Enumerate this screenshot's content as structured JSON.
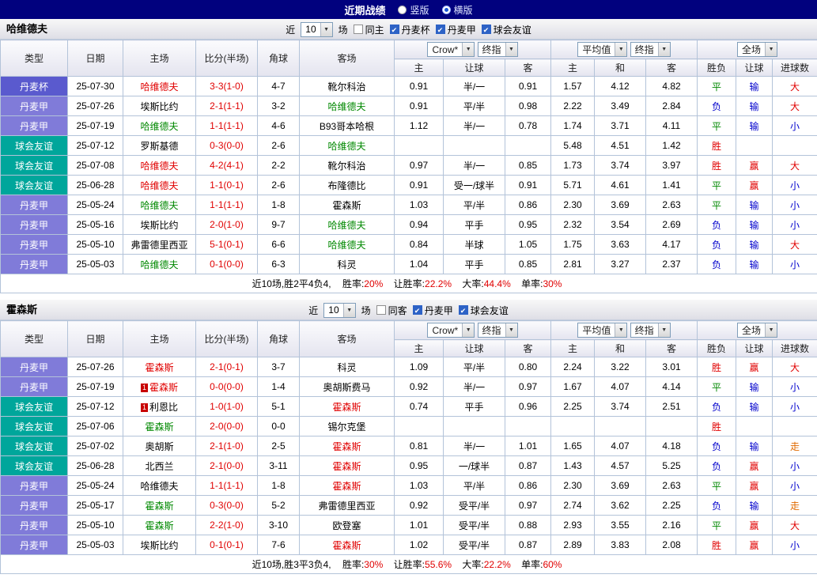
{
  "titlebar": {
    "title": "近期战绩",
    "radios": [
      {
        "label": "竖版",
        "checked": false
      },
      {
        "label": "横版",
        "checked": true
      }
    ]
  },
  "columns": {
    "type": "类型",
    "date": "日期",
    "home": "主场",
    "score": "比分(半场)",
    "corner": "角球",
    "away": "客场",
    "odds_home": "主",
    "odds_line": "让球",
    "odds_away": "客",
    "avg_home": "主",
    "avg_draw": "和",
    "avg_away": "客",
    "res_wdl": "胜负",
    "res_handicap": "让球",
    "res_goals": "进球数"
  },
  "league_colors": {
    "cup": "#5a5ace",
    "league": "#807bd9",
    "friendly": "#00a69b"
  },
  "result_colors": {
    "win": "#e00000",
    "draw": "#008800",
    "loss": "#0000cc",
    "push": "#e06a00"
  },
  "sections": [
    {
      "team": "哈维德夫",
      "filter": {
        "near": "近",
        "count": "10",
        "matches": "场",
        "checkboxes": [
          {
            "label": "同主",
            "checked": false
          },
          {
            "label": "丹麦杯",
            "checked": true
          },
          {
            "label": "丹麦甲",
            "checked": true
          },
          {
            "label": "球会友谊",
            "checked": true
          }
        ]
      },
      "dropdowns": {
        "bookmaker": "Crow*",
        "book_time": "终指",
        "avg": "平均值",
        "avg_time": "终指",
        "scope": "全场"
      },
      "rows": [
        {
          "league": "丹麦杯",
          "cls": "cup",
          "date": "25-07-30",
          "home": {
            "name": "哈维德夫",
            "color": "red"
          },
          "score": "3-3(1-0)",
          "corner": "4-7",
          "away": {
            "name": "靴尔科治",
            "color": "black"
          },
          "odds": [
            "0.91",
            "半/一",
            "0.91"
          ],
          "avg": [
            "1.57",
            "4.12",
            "4.82"
          ],
          "wdl": {
            "t": "平",
            "c": "green"
          },
          "let": {
            "t": "输",
            "c": "blue"
          },
          "goal": {
            "t": "大",
            "c": "red"
          }
        },
        {
          "league": "丹麦甲",
          "cls": "league",
          "date": "25-07-26",
          "home": {
            "name": "埃斯比约",
            "color": "black"
          },
          "score": "2-1(1-1)",
          "corner": "3-2",
          "away": {
            "name": "哈维德夫",
            "color": "green"
          },
          "odds": [
            "0.91",
            "平/半",
            "0.98"
          ],
          "avg": [
            "2.22",
            "3.49",
            "2.84"
          ],
          "wdl": {
            "t": "负",
            "c": "blue"
          },
          "let": {
            "t": "输",
            "c": "blue"
          },
          "goal": {
            "t": "大",
            "c": "red"
          }
        },
        {
          "league": "丹麦甲",
          "cls": "league",
          "date": "25-07-19",
          "home": {
            "name": "哈维德夫",
            "color": "green"
          },
          "score": "1-1(1-1)",
          "corner": "4-6",
          "away": {
            "name": "B93哥本哈根",
            "color": "black"
          },
          "odds": [
            "1.12",
            "半/一",
            "0.78"
          ],
          "avg": [
            "1.74",
            "3.71",
            "4.11"
          ],
          "wdl": {
            "t": "平",
            "c": "green"
          },
          "let": {
            "t": "输",
            "c": "blue"
          },
          "goal": {
            "t": "小",
            "c": "blue"
          }
        },
        {
          "league": "球会友谊",
          "cls": "friendly",
          "date": "25-07-12",
          "home": {
            "name": "罗斯基德",
            "color": "black"
          },
          "score": "0-3(0-0)",
          "corner": "2-6",
          "away": {
            "name": "哈维德夫",
            "color": "green"
          },
          "odds": [
            "",
            "",
            ""
          ],
          "avg": [
            "5.48",
            "4.51",
            "1.42"
          ],
          "wdl": {
            "t": "胜",
            "c": "red"
          },
          "let": {
            "t": "",
            "c": "black"
          },
          "goal": {
            "t": "",
            "c": "black"
          }
        },
        {
          "league": "球会友谊",
          "cls": "friendly",
          "date": "25-07-08",
          "home": {
            "name": "哈维德夫",
            "color": "red"
          },
          "score": "4-2(4-1)",
          "corner": "2-2",
          "away": {
            "name": "靴尔科治",
            "color": "black"
          },
          "odds": [
            "0.97",
            "半/一",
            "0.85"
          ],
          "avg": [
            "1.73",
            "3.74",
            "3.97"
          ],
          "wdl": {
            "t": "胜",
            "c": "red"
          },
          "let": {
            "t": "赢",
            "c": "red"
          },
          "goal": {
            "t": "大",
            "c": "red"
          }
        },
        {
          "league": "球会友谊",
          "cls": "friendly",
          "date": "25-06-28",
          "home": {
            "name": "哈维德夫",
            "color": "red"
          },
          "score": "1-1(0-1)",
          "corner": "2-6",
          "away": {
            "name": "布隆德比",
            "color": "black"
          },
          "odds": [
            "0.91",
            "受一/球半",
            "0.91"
          ],
          "avg": [
            "5.71",
            "4.61",
            "1.41"
          ],
          "wdl": {
            "t": "平",
            "c": "green"
          },
          "let": {
            "t": "赢",
            "c": "red"
          },
          "goal": {
            "t": "小",
            "c": "blue"
          }
        },
        {
          "league": "丹麦甲",
          "cls": "league",
          "date": "25-05-24",
          "home": {
            "name": "哈维德夫",
            "color": "green"
          },
          "score": "1-1(1-1)",
          "corner": "1-8",
          "away": {
            "name": "霍森斯",
            "color": "black"
          },
          "odds": [
            "1.03",
            "平/半",
            "0.86"
          ],
          "avg": [
            "2.30",
            "3.69",
            "2.63"
          ],
          "wdl": {
            "t": "平",
            "c": "green"
          },
          "let": {
            "t": "输",
            "c": "blue"
          },
          "goal": {
            "t": "小",
            "c": "blue"
          }
        },
        {
          "league": "丹麦甲",
          "cls": "league",
          "date": "25-05-16",
          "home": {
            "name": "埃斯比约",
            "color": "black"
          },
          "score": "2-0(1-0)",
          "corner": "9-7",
          "away": {
            "name": "哈维德夫",
            "color": "green"
          },
          "odds": [
            "0.94",
            "平手",
            "0.95"
          ],
          "avg": [
            "2.32",
            "3.54",
            "2.69"
          ],
          "wdl": {
            "t": "负",
            "c": "blue"
          },
          "let": {
            "t": "输",
            "c": "blue"
          },
          "goal": {
            "t": "小",
            "c": "blue"
          }
        },
        {
          "league": "丹麦甲",
          "cls": "league",
          "date": "25-05-10",
          "home": {
            "name": "弗雷德里西亚",
            "color": "black"
          },
          "score": "5-1(0-1)",
          "corner": "6-6",
          "away": {
            "name": "哈维德夫",
            "color": "green"
          },
          "odds": [
            "0.84",
            "半球",
            "1.05"
          ],
          "avg": [
            "1.75",
            "3.63",
            "4.17"
          ],
          "wdl": {
            "t": "负",
            "c": "blue"
          },
          "let": {
            "t": "输",
            "c": "blue"
          },
          "goal": {
            "t": "大",
            "c": "red"
          }
        },
        {
          "league": "丹麦甲",
          "cls": "league",
          "date": "25-05-03",
          "home": {
            "name": "哈维德夫",
            "color": "green"
          },
          "score": "0-1(0-0)",
          "corner": "6-3",
          "away": {
            "name": "科灵",
            "color": "black"
          },
          "odds": [
            "1.04",
            "平手",
            "0.85"
          ],
          "avg": [
            "2.81",
            "3.27",
            "2.37"
          ],
          "wdl": {
            "t": "负",
            "c": "blue"
          },
          "let": {
            "t": "输",
            "c": "blue"
          },
          "goal": {
            "t": "小",
            "c": "blue"
          }
        }
      ],
      "summary": {
        "prefix": "近10场,胜2平4负4,",
        "stats": [
          {
            "label": "胜率:",
            "value": "20%"
          },
          {
            "label": "让胜率:",
            "value": "22.2%"
          },
          {
            "label": "大率:",
            "value": "44.4%"
          },
          {
            "label": "单率:",
            "value": "30%"
          }
        ]
      }
    },
    {
      "team": "霍森斯",
      "filter": {
        "near": "近",
        "count": "10",
        "matches": "场",
        "checkboxes": [
          {
            "label": "同客",
            "checked": false
          },
          {
            "label": "丹麦甲",
            "checked": true
          },
          {
            "label": "球会友谊",
            "checked": true
          }
        ]
      },
      "dropdowns": {
        "bookmaker": "Crow*",
        "book_time": "终指",
        "avg": "平均值",
        "avg_time": "终指",
        "scope": "全场"
      },
      "rows": [
        {
          "league": "丹麦甲",
          "cls": "league",
          "date": "25-07-26",
          "home": {
            "name": "霍森斯",
            "color": "red"
          },
          "score": "2-1(0-1)",
          "corner": "3-7",
          "away": {
            "name": "科灵",
            "color": "black"
          },
          "odds": [
            "1.09",
            "平/半",
            "0.80"
          ],
          "avg": [
            "2.24",
            "3.22",
            "3.01"
          ],
          "wdl": {
            "t": "胜",
            "c": "red"
          },
          "let": {
            "t": "赢",
            "c": "red"
          },
          "goal": {
            "t": "大",
            "c": "red"
          }
        },
        {
          "league": "丹麦甲",
          "cls": "league",
          "date": "25-07-19",
          "home": {
            "name": "霍森斯",
            "color": "red",
            "badge": "1"
          },
          "score": "0-0(0-0)",
          "corner": "1-4",
          "away": {
            "name": "奥胡斯费马",
            "color": "black"
          },
          "odds": [
            "0.92",
            "半/一",
            "0.97"
          ],
          "avg": [
            "1.67",
            "4.07",
            "4.14"
          ],
          "wdl": {
            "t": "平",
            "c": "green"
          },
          "let": {
            "t": "输",
            "c": "blue"
          },
          "goal": {
            "t": "小",
            "c": "blue"
          }
        },
        {
          "league": "球会友谊",
          "cls": "friendly",
          "date": "25-07-12",
          "home": {
            "name": "利恩比",
            "color": "black",
            "badge": "1"
          },
          "score": "1-0(1-0)",
          "corner": "5-1",
          "away": {
            "name": "霍森斯",
            "color": "red"
          },
          "odds": [
            "0.74",
            "平手",
            "0.96"
          ],
          "avg": [
            "2.25",
            "3.74",
            "2.51"
          ],
          "wdl": {
            "t": "负",
            "c": "blue"
          },
          "let": {
            "t": "输",
            "c": "blue"
          },
          "goal": {
            "t": "小",
            "c": "blue"
          }
        },
        {
          "league": "球会友谊",
          "cls": "friendly",
          "date": "25-07-06",
          "home": {
            "name": "霍森斯",
            "color": "green"
          },
          "score": "2-0(0-0)",
          "corner": "0-0",
          "away": {
            "name": "锡尔克堡",
            "color": "black"
          },
          "odds": [
            "",
            "",
            ""
          ],
          "avg": [
            "",
            "",
            ""
          ],
          "wdl": {
            "t": "胜",
            "c": "red"
          },
          "let": {
            "t": "",
            "c": "black"
          },
          "goal": {
            "t": "",
            "c": "black"
          }
        },
        {
          "league": "球会友谊",
          "cls": "friendly",
          "date": "25-07-02",
          "home": {
            "name": "奥胡斯",
            "color": "black"
          },
          "score": "2-1(1-0)",
          "corner": "2-5",
          "away": {
            "name": "霍森斯",
            "color": "red"
          },
          "odds": [
            "0.81",
            "半/一",
            "1.01"
          ],
          "avg": [
            "1.65",
            "4.07",
            "4.18"
          ],
          "wdl": {
            "t": "负",
            "c": "blue"
          },
          "let": {
            "t": "输",
            "c": "blue"
          },
          "goal": {
            "t": "走",
            "c": "orange"
          }
        },
        {
          "league": "球会友谊",
          "cls": "friendly",
          "date": "25-06-28",
          "home": {
            "name": "北西兰",
            "color": "black"
          },
          "score": "2-1(0-0)",
          "corner": "3-11",
          "away": {
            "name": "霍森斯",
            "color": "red"
          },
          "odds": [
            "0.95",
            "一/球半",
            "0.87"
          ],
          "avg": [
            "1.43",
            "4.57",
            "5.25"
          ],
          "wdl": {
            "t": "负",
            "c": "blue"
          },
          "let": {
            "t": "赢",
            "c": "red"
          },
          "goal": {
            "t": "小",
            "c": "blue"
          }
        },
        {
          "league": "丹麦甲",
          "cls": "league",
          "date": "25-05-24",
          "home": {
            "name": "哈维德夫",
            "color": "black"
          },
          "score": "1-1(1-1)",
          "corner": "1-8",
          "away": {
            "name": "霍森斯",
            "color": "red"
          },
          "odds": [
            "1.03",
            "平/半",
            "0.86"
          ],
          "avg": [
            "2.30",
            "3.69",
            "2.63"
          ],
          "wdl": {
            "t": "平",
            "c": "green"
          },
          "let": {
            "t": "赢",
            "c": "red"
          },
          "goal": {
            "t": "小",
            "c": "blue"
          }
        },
        {
          "league": "丹麦甲",
          "cls": "league",
          "date": "25-05-17",
          "home": {
            "name": "霍森斯",
            "color": "green"
          },
          "score": "0-3(0-0)",
          "corner": "5-2",
          "away": {
            "name": "弗雷德里西亚",
            "color": "black"
          },
          "odds": [
            "0.92",
            "受平/半",
            "0.97"
          ],
          "avg": [
            "2.74",
            "3.62",
            "2.25"
          ],
          "wdl": {
            "t": "负",
            "c": "blue"
          },
          "let": {
            "t": "输",
            "c": "blue"
          },
          "goal": {
            "t": "走",
            "c": "orange"
          }
        },
        {
          "league": "丹麦甲",
          "cls": "league",
          "date": "25-05-10",
          "home": {
            "name": "霍森斯",
            "color": "green"
          },
          "score": "2-2(1-0)",
          "corner": "3-10",
          "away": {
            "name": "欧登塞",
            "color": "black"
          },
          "odds": [
            "1.01",
            "受平/半",
            "0.88"
          ],
          "avg": [
            "2.93",
            "3.55",
            "2.16"
          ],
          "wdl": {
            "t": "平",
            "c": "green"
          },
          "let": {
            "t": "赢",
            "c": "red"
          },
          "goal": {
            "t": "大",
            "c": "red"
          }
        },
        {
          "league": "丹麦甲",
          "cls": "league",
          "date": "25-05-03",
          "home": {
            "name": "埃斯比约",
            "color": "black"
          },
          "score": "0-1(0-1)",
          "corner": "7-6",
          "away": {
            "name": "霍森斯",
            "color": "red"
          },
          "odds": [
            "1.02",
            "受平/半",
            "0.87"
          ],
          "avg": [
            "2.89",
            "3.83",
            "2.08"
          ],
          "wdl": {
            "t": "胜",
            "c": "red"
          },
          "let": {
            "t": "赢",
            "c": "red"
          },
          "goal": {
            "t": "小",
            "c": "blue"
          }
        }
      ],
      "summary": {
        "prefix": "近10场,胜3平3负4,",
        "stats": [
          {
            "label": "胜率:",
            "value": "30%"
          },
          {
            "label": "让胜率:",
            "value": "55.6%"
          },
          {
            "label": "大率:",
            "value": "22.2%"
          },
          {
            "label": "单率:",
            "value": "60%"
          }
        ]
      }
    }
  ]
}
